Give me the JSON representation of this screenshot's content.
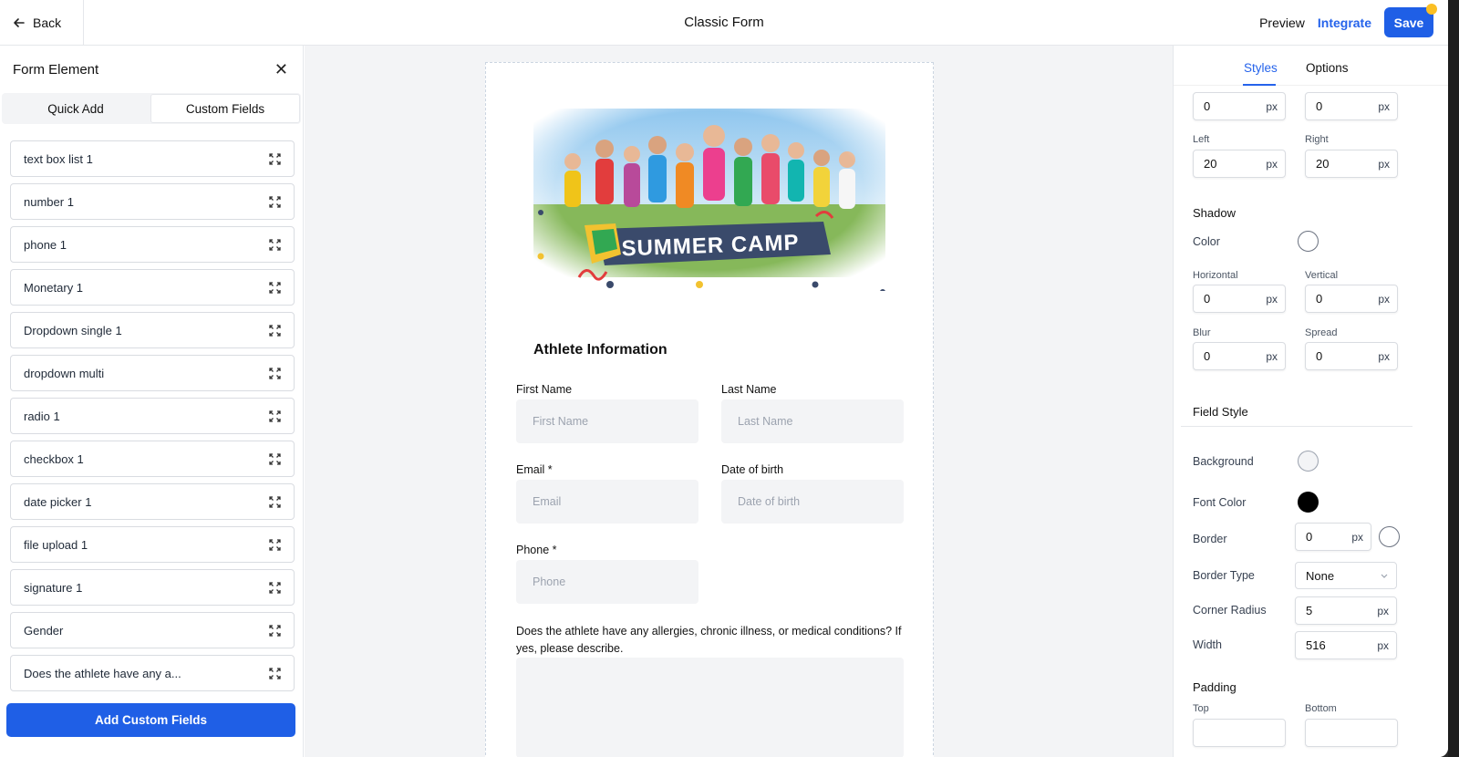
{
  "header": {
    "back_label": "Back",
    "title": "Classic Form",
    "preview_label": "Preview",
    "integrate_label": "Integrate",
    "save_label": "Save"
  },
  "left_panel": {
    "title": "Form Element",
    "tabs": [
      {
        "label": "Quick Add",
        "active": false
      },
      {
        "label": "Custom Fields",
        "active": true
      }
    ],
    "fields": [
      "text box list 1",
      "number 1",
      "phone 1",
      "Monetary 1",
      "Dropdown single 1",
      "dropdown multi",
      "radio 1",
      "checkbox 1",
      "date picker 1",
      "file upload 1",
      "signature 1",
      "Gender",
      "Does the athlete have any a..."
    ],
    "add_button_label": "Add Custom Fields"
  },
  "form": {
    "banner_text": "SUMMER CAMP",
    "section_title": "Athlete Information",
    "first_name_label": "First Name",
    "first_name_placeholder": "First Name",
    "last_name_label": "Last Name",
    "last_name_placeholder": "Last Name",
    "email_label": "Email *",
    "email_placeholder": "Email",
    "dob_label": "Date of birth",
    "dob_placeholder": "Date of birth",
    "phone_label": "Phone *",
    "phone_placeholder": "Phone",
    "question": "Does the athlete have any allergies, chronic illness, or medical conditions? If yes, please describe."
  },
  "right_panel": {
    "tabs": [
      {
        "label": "Styles",
        "active": true
      },
      {
        "label": "Options",
        "active": false
      }
    ],
    "unit": "px",
    "top_row": {
      "left_value": "0",
      "right_value": "0"
    },
    "left_label": "Left",
    "left_value": "20",
    "right_label": "Right",
    "right_value": "20",
    "shadow": {
      "title": "Shadow",
      "color_label": "Color",
      "color": "#ffffff",
      "horizontal_label": "Horizontal",
      "horizontal_value": "0",
      "vertical_label": "Vertical",
      "vertical_value": "0",
      "blur_label": "Blur",
      "blur_value": "0",
      "spread_label": "Spread",
      "spread_value": "0"
    },
    "field_style": {
      "title": "Field Style",
      "background_label": "Background",
      "background_color": "#f3f4f6",
      "font_color_label": "Font Color",
      "font_color": "#000000",
      "border_label": "Border",
      "border_value": "0",
      "border_color": "#ffffff",
      "border_type_label": "Border Type",
      "border_type_value": "None",
      "corner_radius_label": "Corner Radius",
      "corner_radius_value": "5",
      "width_label": "Width",
      "width_value": "516"
    },
    "padding": {
      "title": "Padding",
      "top_label": "Top",
      "bottom_label": "Bottom"
    }
  },
  "colors": {
    "accent": "#1f5fe6",
    "link": "#2563eb",
    "notification_dot": "#fbbf24"
  }
}
